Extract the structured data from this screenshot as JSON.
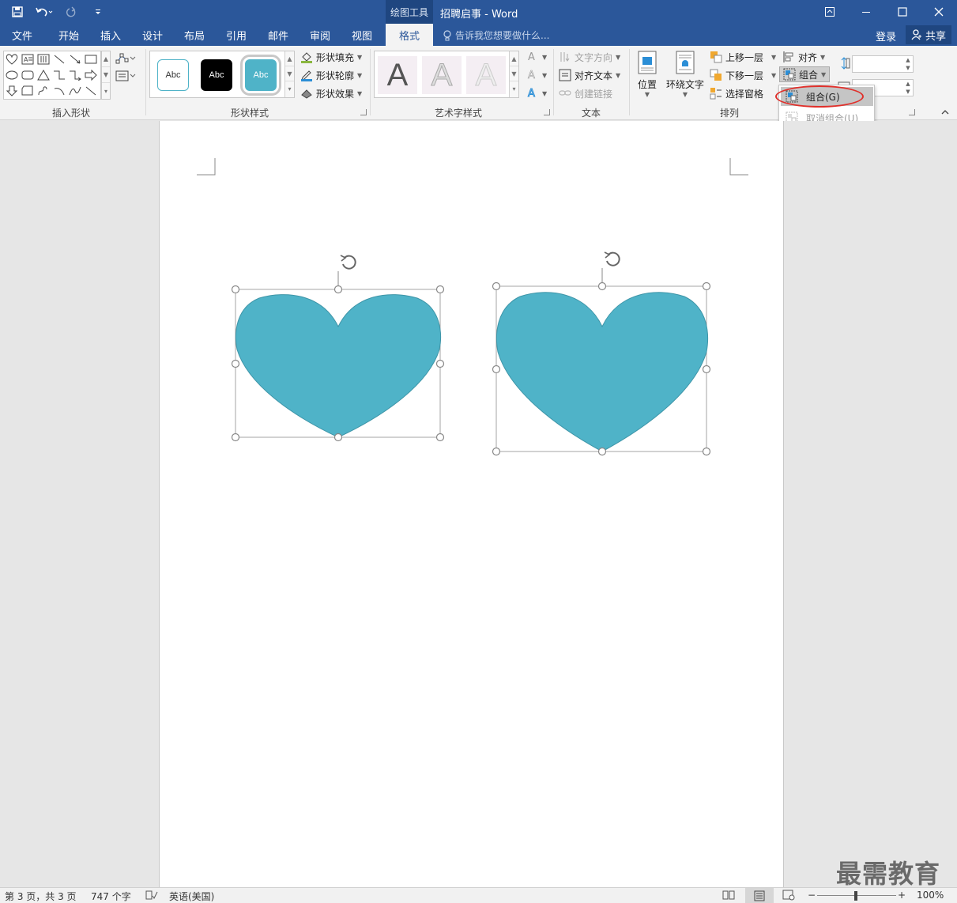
{
  "titlebar": {
    "context_tab": "绘图工具",
    "document_title": "招聘启事 - Word"
  },
  "tabs": [
    {
      "label": "文件"
    },
    {
      "label": "开始"
    },
    {
      "label": "插入"
    },
    {
      "label": "设计"
    },
    {
      "label": "布局"
    },
    {
      "label": "引用"
    },
    {
      "label": "邮件"
    },
    {
      "label": "审阅"
    },
    {
      "label": "视图"
    },
    {
      "label": "格式"
    }
  ],
  "tellme_placeholder": "告诉我您想要做什么...",
  "account": {
    "login": "登录",
    "share": "共享"
  },
  "ribbon": {
    "insert_shapes_label": "插入形状",
    "shape_styles": {
      "label": "形状样式",
      "swatch_text": "Abc",
      "fill": "形状填充",
      "outline": "形状轮廓",
      "effects": "形状效果"
    },
    "wordart": {
      "label": "艺术字样式",
      "letter": "A"
    },
    "text": {
      "label": "文本",
      "direction": "文字方向",
      "align": "对齐文本",
      "link": "创建链接"
    },
    "arrange": {
      "label": "排列",
      "position": "位置",
      "wrap": "环绕文字",
      "forward": "上移一层",
      "backward": "下移一层",
      "selection_pane": "选择窗格",
      "align": "对齐",
      "group": "组合"
    }
  },
  "group_menu": {
    "group": "组合(G)",
    "ungroup": "取消组合(U)"
  },
  "colors": {
    "heart_fill": "#4fb3c8",
    "accent": "#2b579a",
    "highlight": "#e0302b"
  },
  "statusbar": {
    "pages": "第 3 页，共 3 页",
    "words": "747 个字",
    "language": "英语(美国)",
    "zoom": "100%"
  },
  "watermark": "最需教育"
}
